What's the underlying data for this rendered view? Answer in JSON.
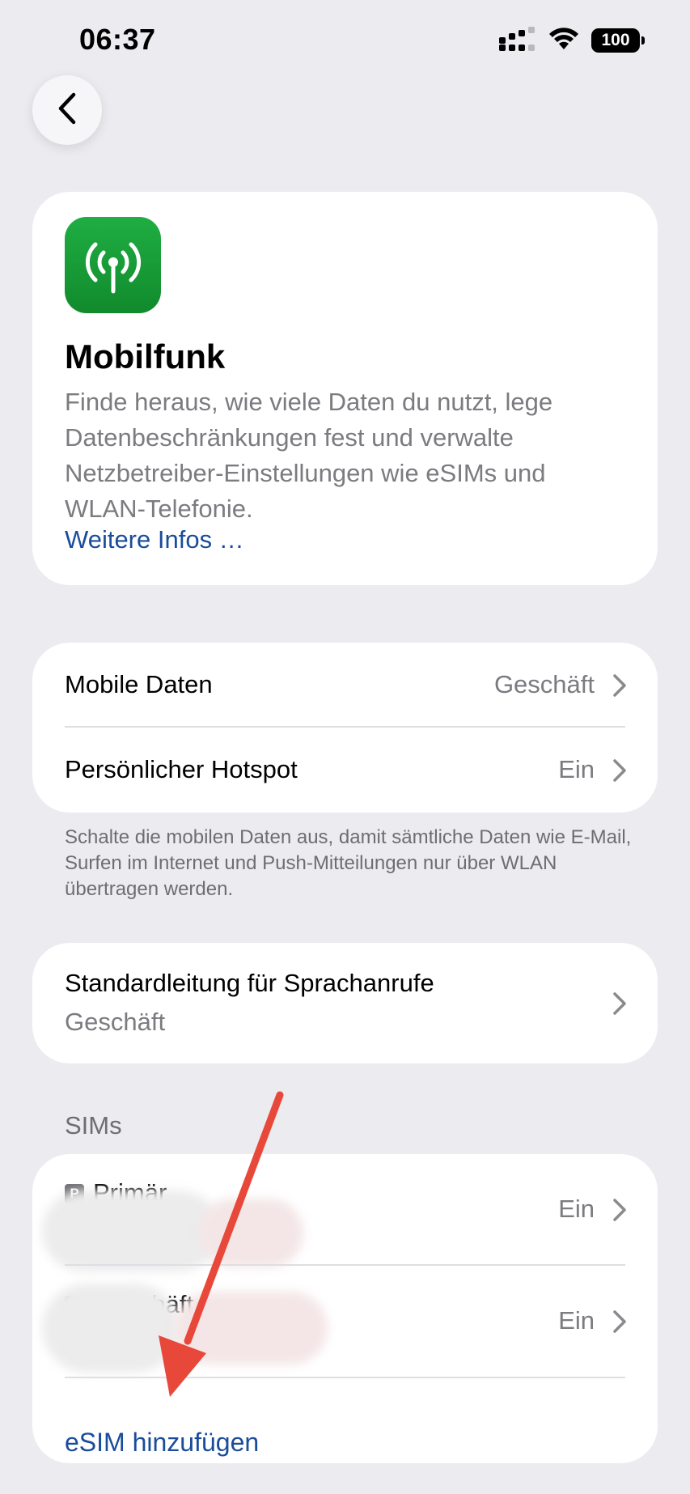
{
  "status_bar": {
    "time": "06:37",
    "battery": "100",
    "icons": [
      "signal-dual-sim-icon",
      "wifi-icon",
      "battery-icon"
    ]
  },
  "nav": {
    "back_icon": "chevron-left-icon"
  },
  "info": {
    "icon": "cellular-antenna-icon",
    "title": "Mobilfunk",
    "description": "Finde heraus, wie viele Daten du nutzt, lege Datenbeschränkungen fest und verwalte Netzbetreiber-Einstellungen wie eSIMs und WLAN-Telefonie.",
    "link": "Weitere Infos …"
  },
  "data_group": {
    "rows": [
      {
        "label": "Mobile Daten",
        "value": "Geschäft"
      },
      {
        "label": "Persönlicher Hotspot",
        "value": "Ein"
      }
    ],
    "footnote": "Schalte die mobilen Daten aus, damit sämtliche Daten wie E-Mail, Surfen im Internet und Push-Mitteilungen nur über WLAN übertragen werden."
  },
  "voice": {
    "label": "Standardleitung für Sprachanrufe",
    "value": "Geschäft"
  },
  "sims": {
    "header": "SIMs",
    "items": [
      {
        "badge": "P",
        "label": "Primär",
        "value": "Ein"
      },
      {
        "badge": "G",
        "label": "Geschäft",
        "value": "Ein"
      }
    ],
    "add_label": "eSIM hinzufügen"
  },
  "colors": {
    "background": "#ebebf0",
    "link": "#1a4c9c",
    "app_icon_green": "#17a03a",
    "annotation_arrow": "#e8483a"
  }
}
